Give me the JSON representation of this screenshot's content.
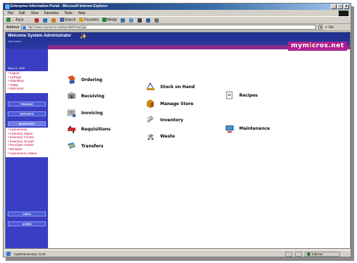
{
  "window": {
    "title": "Enterprise Information Portal - Microsoft Internet Explorer",
    "minimize": "_",
    "maximize": "□",
    "close": "x"
  },
  "menubar": [
    "File",
    "Edit",
    "View",
    "Favorites",
    "Tools",
    "Help"
  ],
  "toolbar": {
    "back": "← Back",
    "forward": "→",
    "search": "Search",
    "favorites": "Favorites",
    "media": "Media"
  },
  "address": {
    "label": "Address",
    "url": "http://www.mymicros.net/servlet/Portal.jsp",
    "go": "Go"
  },
  "header": {
    "welcome": "Welcome System Administrator",
    "subtitle": "Test Admin",
    "brand_prefix": "mym",
    "brand_x": "i",
    "brand_suffix": "cros.net"
  },
  "sidebar": {
    "date": "May 19, 2005",
    "links": [
      "Logout",
      "myPage",
      "OpenBots",
      "Today",
      "Welcome!"
    ],
    "buttons": [
      "FINANCE",
      "REPORTS",
      "INVENTORY"
    ],
    "inventory_links": [
      "myInventory",
      "Inventory Status",
      "Inventory Counts",
      "Inventory Groups",
      "Purchase Orders",
      "Receipts",
      "myInventory Status"
    ],
    "bottom_buttons": [
      "LINKS",
      "ADMIN"
    ]
  },
  "menu": {
    "ordering": "Ordering",
    "receiving": "Receiving",
    "invoicing": "Invoicing",
    "requisitions": "Requisitions",
    "transfers": "Transfers",
    "stock_on_hand": "Stock on Hand",
    "manage_store": "Manage Store",
    "inventory": "Inventory",
    "waste": "Waste",
    "recipes": "Recipes",
    "maintenance": "Maintenance"
  },
  "status": {
    "text": "mySimInventory v1.34",
    "zone": "Internet"
  },
  "colors": {
    "header": "#1e2f8c",
    "sidebar": "#3a3ec4",
    "brand": "#b02090",
    "link": "#c0003a"
  }
}
